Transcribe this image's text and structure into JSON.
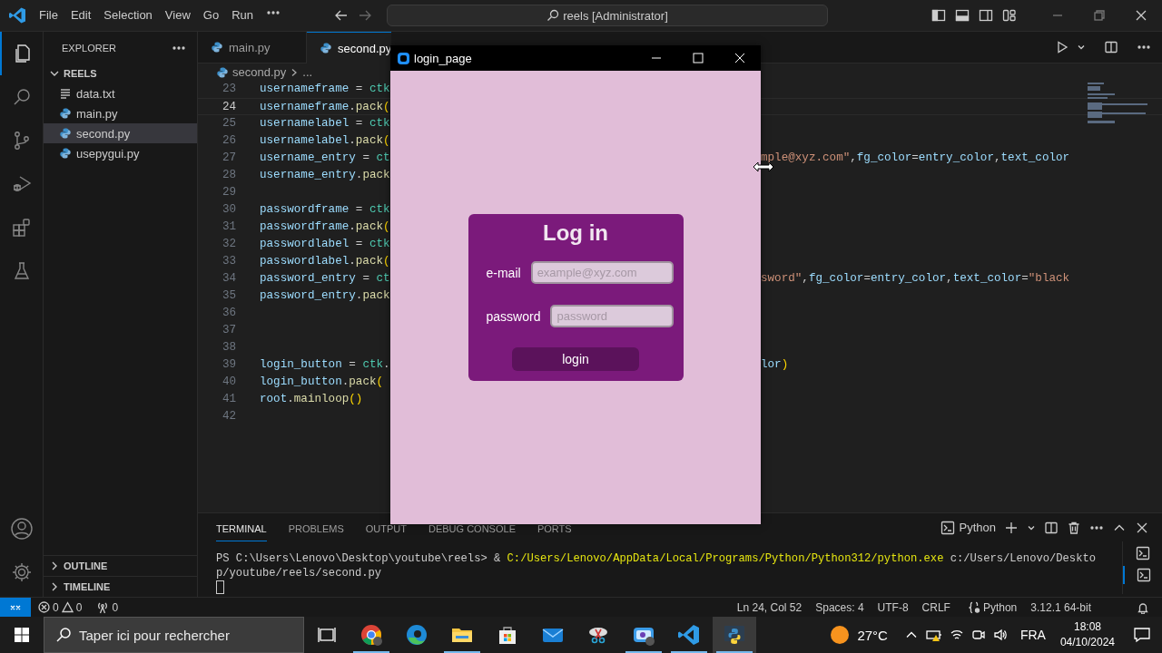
{
  "titlebar": {
    "menus": [
      "File",
      "Edit",
      "Selection",
      "View",
      "Go",
      "Run"
    ],
    "command_center": "reels [Administrator]"
  },
  "activity_bar": [
    {
      "selected": true
    },
    {
      "selected": false
    },
    {
      "selected": false
    },
    {
      "selected": false
    },
    {
      "selected": false
    },
    {
      "selected": false
    }
  ],
  "sidebar": {
    "title": "EXPLORER",
    "folder": {
      "name": "REELS",
      "expanded": true,
      "files": [
        {
          "name": "data.txt",
          "kind": "text",
          "selected": false
        },
        {
          "name": "main.py",
          "kind": "python",
          "selected": false
        },
        {
          "name": "second.py",
          "kind": "python",
          "selected": true
        },
        {
          "name": "usepygui.py",
          "kind": "python",
          "selected": false
        }
      ]
    },
    "sections": [
      {
        "name": "OUTLINE",
        "expanded": false
      },
      {
        "name": "TIMELINE",
        "expanded": false
      }
    ]
  },
  "editor": {
    "tabs": [
      {
        "label": "main.py",
        "selected": false
      },
      {
        "label": "second.py",
        "selected": true
      }
    ],
    "breadcrumb": {
      "file": "second.py",
      "rest": "..."
    },
    "lines": [
      {
        "number": "23",
        "current": false,
        "left": [
          {
            "kind": "variable",
            "text": "usernameframe "
          },
          {
            "kind": "operator",
            "text": "= "
          },
          {
            "kind": "module",
            "text": "ctk"
          }
        ]
      },
      {
        "number": "24",
        "current": true,
        "left": [
          {
            "kind": "variable",
            "text": "usernameframe"
          },
          {
            "kind": "operator",
            "text": "."
          },
          {
            "kind": "function",
            "text": "pack"
          },
          {
            "kind": "bracket",
            "text": "("
          }
        ]
      },
      {
        "number": "25",
        "current": false,
        "left": [
          {
            "kind": "variable",
            "text": "usernamelabel "
          },
          {
            "kind": "operator",
            "text": "= "
          },
          {
            "kind": "module",
            "text": "ctk"
          }
        ]
      },
      {
        "number": "26",
        "current": false,
        "left": [
          {
            "kind": "variable",
            "text": "usernamelabel"
          },
          {
            "kind": "operator",
            "text": "."
          },
          {
            "kind": "function",
            "text": "pack"
          },
          {
            "kind": "bracket",
            "text": "("
          }
        ]
      },
      {
        "number": "27",
        "current": false,
        "left": [
          {
            "kind": "variable",
            "text": "username_entry "
          },
          {
            "kind": "operator",
            "text": "= "
          },
          {
            "kind": "module",
            "text": "ct"
          }
        ],
        "right": [
          {
            "kind": "string",
            "text": "mple@xyz.com\""
          },
          {
            "kind": "operator",
            "text": ","
          },
          {
            "kind": "variable",
            "text": "fg_color"
          },
          {
            "kind": "operator",
            "text": "="
          },
          {
            "kind": "variable",
            "text": "entry_color"
          },
          {
            "kind": "operator",
            "text": ","
          },
          {
            "kind": "variable",
            "text": "text_color"
          }
        ]
      },
      {
        "number": "28",
        "current": false,
        "left": [
          {
            "kind": "variable",
            "text": "username_entry"
          },
          {
            "kind": "operator",
            "text": "."
          },
          {
            "kind": "function",
            "text": "pack"
          }
        ]
      },
      {
        "number": "29",
        "current": false
      },
      {
        "number": "30",
        "current": false,
        "left": [
          {
            "kind": "variable",
            "text": "passwordframe "
          },
          {
            "kind": "operator",
            "text": "= "
          },
          {
            "kind": "module",
            "text": "ctk"
          }
        ]
      },
      {
        "number": "31",
        "current": false,
        "left": [
          {
            "kind": "variable",
            "text": "passwordframe"
          },
          {
            "kind": "operator",
            "text": "."
          },
          {
            "kind": "function",
            "text": "pack"
          },
          {
            "kind": "bracket",
            "text": "("
          }
        ]
      },
      {
        "number": "32",
        "current": false,
        "left": [
          {
            "kind": "variable",
            "text": "passwordlabel "
          },
          {
            "kind": "operator",
            "text": "= "
          },
          {
            "kind": "module",
            "text": "ctk"
          }
        ]
      },
      {
        "number": "33",
        "current": false,
        "left": [
          {
            "kind": "variable",
            "text": "passwordlabel"
          },
          {
            "kind": "operator",
            "text": "."
          },
          {
            "kind": "function",
            "text": "pack"
          },
          {
            "kind": "bracket",
            "text": "("
          }
        ]
      },
      {
        "number": "34",
        "current": false,
        "left": [
          {
            "kind": "variable",
            "text": "password_entry "
          },
          {
            "kind": "operator",
            "text": "= "
          },
          {
            "kind": "module",
            "text": "ct"
          }
        ],
        "right": [
          {
            "kind": "string",
            "text": "sword\""
          },
          {
            "kind": "operator",
            "text": ","
          },
          {
            "kind": "variable",
            "text": "fg_color"
          },
          {
            "kind": "operator",
            "text": "="
          },
          {
            "kind": "variable",
            "text": "entry_color"
          },
          {
            "kind": "operator",
            "text": ","
          },
          {
            "kind": "variable",
            "text": "text_color"
          },
          {
            "kind": "operator",
            "text": "="
          },
          {
            "kind": "string",
            "text": "\"black"
          }
        ]
      },
      {
        "number": "35",
        "current": false,
        "left": [
          {
            "kind": "variable",
            "text": "password_entry"
          },
          {
            "kind": "operator",
            "text": "."
          },
          {
            "kind": "function",
            "text": "pack"
          }
        ]
      },
      {
        "number": "36",
        "current": false
      },
      {
        "number": "37",
        "current": false
      },
      {
        "number": "38",
        "current": false
      },
      {
        "number": "39",
        "current": false,
        "left": [
          {
            "kind": "variable",
            "text": "login_button "
          },
          {
            "kind": "operator",
            "text": "= "
          },
          {
            "kind": "module",
            "text": "ctk"
          },
          {
            "kind": "operator",
            "text": "."
          }
        ],
        "right": [
          {
            "kind": "variable",
            "text": "lor"
          },
          {
            "kind": "bracket",
            "text": ")"
          }
        ]
      },
      {
        "number": "40",
        "current": false,
        "left": [
          {
            "kind": "variable",
            "text": "login_button"
          },
          {
            "kind": "operator",
            "text": "."
          },
          {
            "kind": "function",
            "text": "pack"
          },
          {
            "kind": "bracket",
            "text": "("
          }
        ]
      },
      {
        "number": "41",
        "current": false,
        "left": [
          {
            "kind": "variable",
            "text": "root"
          },
          {
            "kind": "operator",
            "text": "."
          },
          {
            "kind": "function",
            "text": "mainloop"
          },
          {
            "kind": "bracket",
            "text": "()"
          }
        ]
      },
      {
        "number": "42",
        "current": false
      }
    ]
  },
  "panel": {
    "tabs": [
      {
        "label": "TERMINAL",
        "selected": true
      },
      {
        "label": "PROBLEMS",
        "selected": false
      },
      {
        "label": "OUTPUT",
        "selected": false
      },
      {
        "label": "DEBUG CONSOLE",
        "selected": false
      },
      {
        "label": "PORTS",
        "selected": false
      }
    ],
    "shell": "Python",
    "terminal_lines": [
      [
        {
          "kind": "plain",
          "text": "PS C:\\Users\\Lenovo\\Desktop\\youtube\\reels> & "
        },
        {
          "kind": "path",
          "text": "C:/Users/Lenovo/AppData/Local/Programs/Python/Python312/python.exe"
        },
        {
          "kind": "plain",
          "text": " c:/Users/Lenovo/Deskto"
        }
      ],
      [
        {
          "kind": "plain",
          "text": "p/youtube/reels/second.py"
        }
      ]
    ],
    "terminals": [
      {
        "selected": false
      },
      {
        "selected": true
      }
    ]
  },
  "status_bar": {
    "errors": "0",
    "warnings": "0",
    "ports": "0",
    "position": "Ln 24, Col 52",
    "indentation": "Spaces: 4",
    "encoding": "UTF-8",
    "line_ending": "CRLF",
    "language": "Python",
    "interpreter": "3.12.1 64-bit"
  },
  "taskbar": {
    "search_placeholder": "Taper ici pour rechercher",
    "apps": [
      {
        "running": true,
        "selected": false
      },
      {
        "running": false,
        "selected": false
      },
      {
        "running": true,
        "selected": false
      },
      {
        "running": false,
        "selected": false
      },
      {
        "running": false,
        "selected": false
      },
      {
        "running": false,
        "selected": false
      },
      {
        "running": true,
        "selected": false
      },
      {
        "running": true,
        "selected": false
      },
      {
        "running": true,
        "selected": true
      }
    ],
    "weather": "27°C",
    "language": "FRA",
    "time": "18:08",
    "date": "04/10/2024"
  },
  "login_window": {
    "title": "login_page",
    "heading": "Log in",
    "fields": [
      {
        "label": "e-mail",
        "placeholder": "example@xyz.com"
      },
      {
        "label": "password",
        "placeholder": "password"
      }
    ],
    "button": "login"
  }
}
